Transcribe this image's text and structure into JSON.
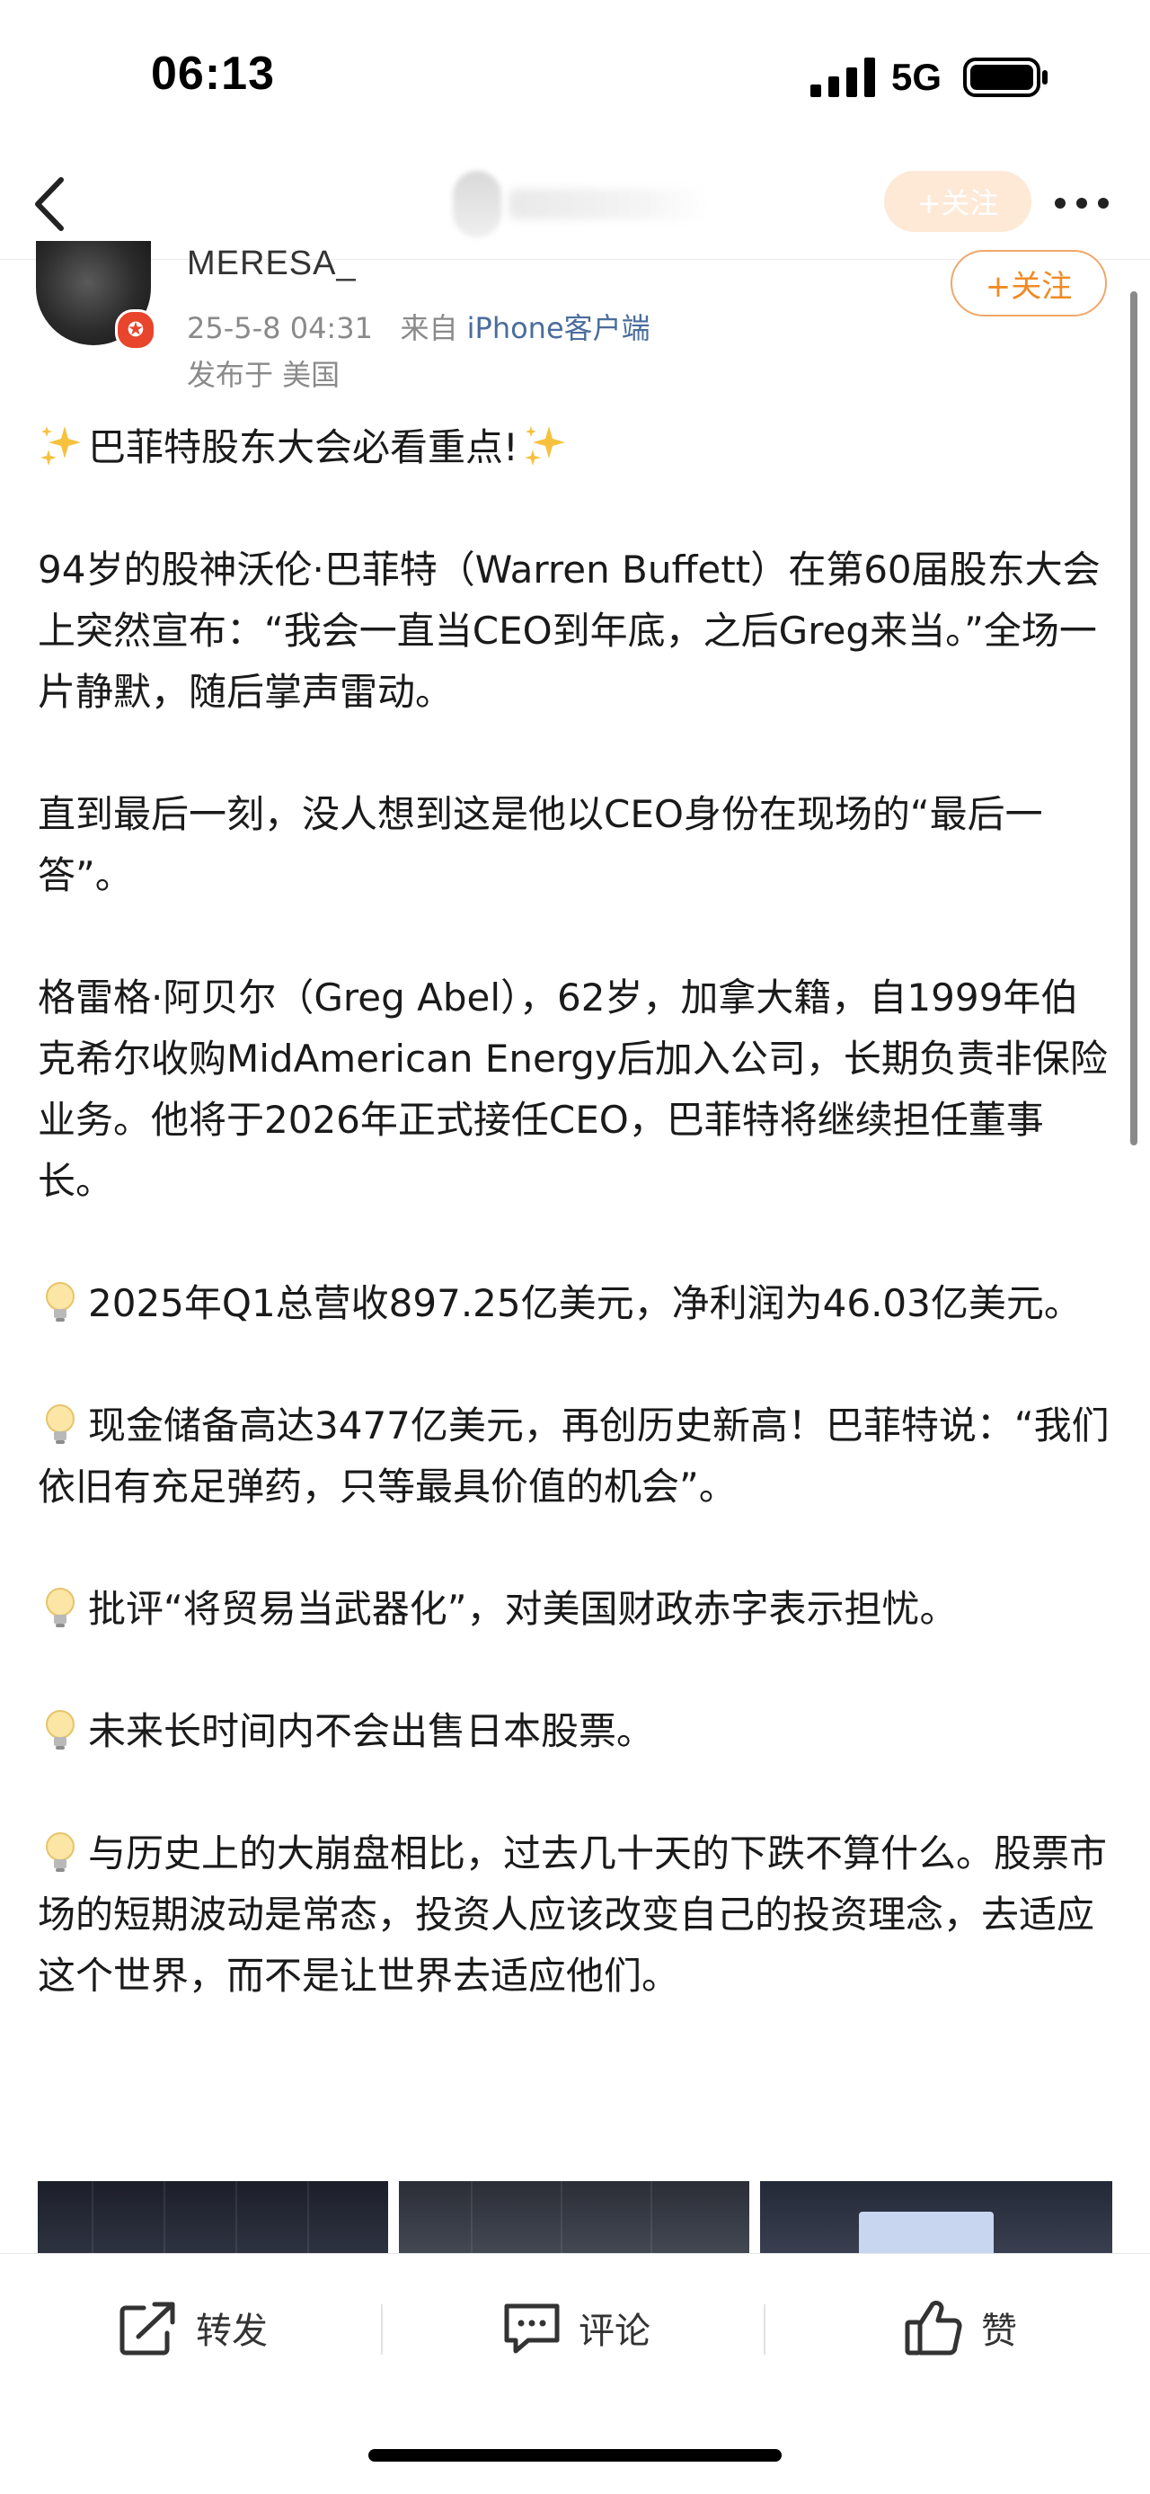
{
  "status_bar": {
    "time": "06:13",
    "network": "5G",
    "icons": [
      "signal-icon",
      "battery-icon"
    ]
  },
  "nav": {
    "back_icon": "chevron-left-icon",
    "follow_label": "+关注",
    "more_icon": "ellipsis-icon"
  },
  "author": {
    "name": "MERESA_",
    "badge_icon": "verified-badge-icon",
    "date": "25-5-8 04:31",
    "source_prefix": "来自",
    "source_app": "iPhone客户端",
    "location": "发布于 美国",
    "follow_label": "+关注"
  },
  "post": {
    "title": "巴菲特股东大会必看重点!",
    "paragraphs": [
      "94岁的股神沃伦·巴菲特（Warren Buffett）在第60届股东大会上突然宣布：“我会一直当CEO到年底，之后Greg来当。”全场一片静默，随后掌声雷动。",
      "直到最后一刻，没人想到这是他以CEO身份在现场的“最后一答”。",
      "格雷格·阿贝尔（Greg Abel），62岁，加拿大籍，自1999年伯克希尔收购MidAmerican Energy后加入公司，长期负责非保险业务。他将于2026年正式接任CEO，巴菲特将继续担任董事长。"
    ],
    "bullets": [
      "2025年Q1总营收897.25亿美元，净利润为46.03亿美元。",
      "现金储备高达3477亿美元，再创历史新高！巴菲特说：“我们依旧有充足弹药，只等最具价值的机会”。",
      "批评“将贸易当武器化”，对美国财政赤字表示担忧。",
      "未来长时间内不会出售日本股票。",
      "与历史上的大崩盘相比，过去几十天的下跌不算什么。股票市场的短期波动是常态，投资人应该改变自己的投资理念，去适应这个世界，而不是让世界去适应他们。"
    ],
    "title_icon": "sparkles-icon",
    "bullet_icon": "light-bulb-icon"
  },
  "images": {
    "count_visible": 3
  },
  "toolbar": {
    "repost_label": "转发",
    "comment_label": "评论",
    "like_label": "赞"
  },
  "colors": {
    "accent_orange": "#f08a24",
    "link_blue": "#4a6d9c",
    "meta_gray": "#8a8a8a"
  }
}
